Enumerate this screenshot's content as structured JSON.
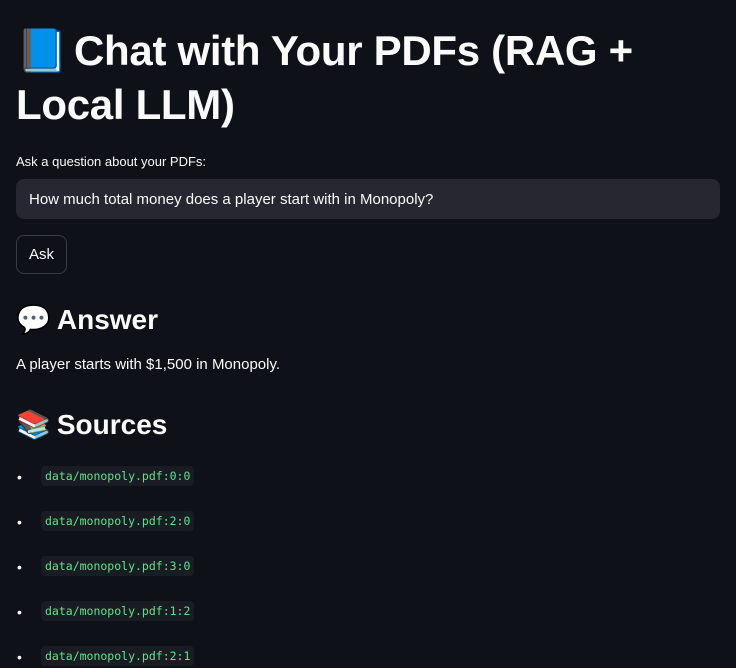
{
  "header": {
    "emoji": "📘",
    "title": "Chat with Your PDFs (RAG + Local LLM)"
  },
  "question": {
    "label": "Ask a question about your PDFs:",
    "value": "How much total money does a player start with in Monopoly?"
  },
  "ask_button": {
    "label": "Ask"
  },
  "answer": {
    "emoji": "💬",
    "heading": "Answer",
    "text": "A player starts with $1,500 in Monopoly."
  },
  "sources": {
    "emoji": "📚",
    "heading": "Sources",
    "items": [
      "data/monopoly.pdf:0:0",
      "data/monopoly.pdf:2:0",
      "data/monopoly.pdf:3:0",
      "data/monopoly.pdf:1:2",
      "data/monopoly.pdf:2:1"
    ]
  },
  "colors": {
    "background": "#0e1117",
    "input_background": "#262730",
    "code_text": "#5ce488",
    "text": "#fafafa"
  }
}
